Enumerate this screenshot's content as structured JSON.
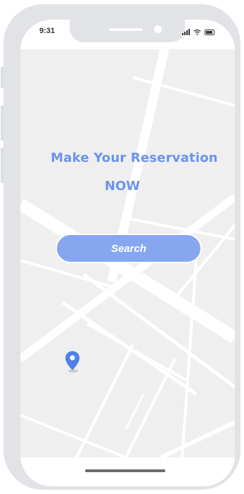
{
  "status_bar": {
    "time": "9:31",
    "icons": [
      "signal-icon",
      "wifi-icon",
      "battery-icon"
    ]
  },
  "main": {
    "title": "Make Your Reservation",
    "subtitle": "NOW",
    "search_label": "Search"
  },
  "map": {
    "pin_icon": "location-pin-icon",
    "pin_color": "#4f7fe8"
  },
  "colors": {
    "accent": "#6a94ec",
    "button": "#86a6ef",
    "frame": "#e1e3e6",
    "map_background": "#efeff0",
    "roads": "#ffffff"
  }
}
